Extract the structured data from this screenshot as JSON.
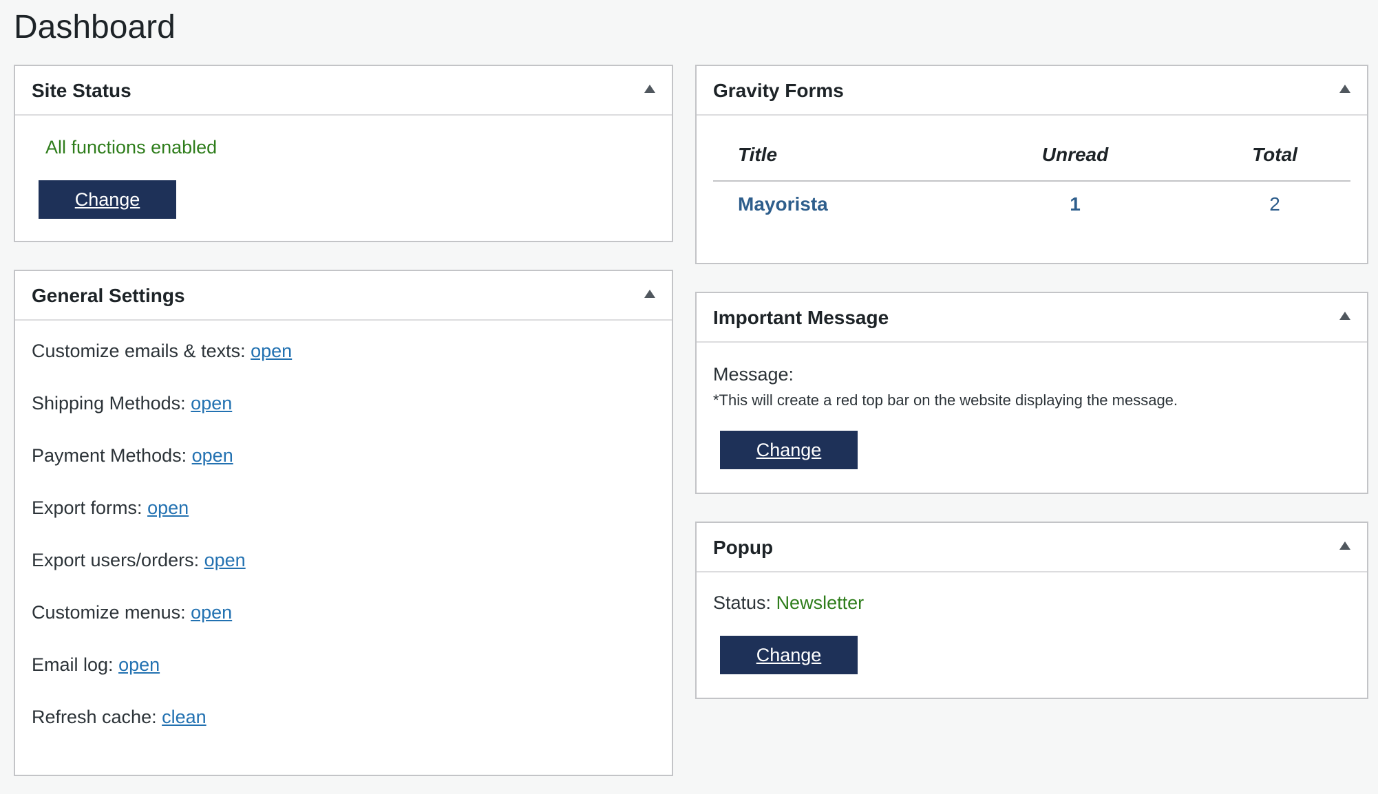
{
  "page": {
    "title": "Dashboard"
  },
  "site_status": {
    "title": "Site Status",
    "status_text": "All functions enabled",
    "button_label": "Change"
  },
  "general_settings": {
    "title": "General Settings",
    "items": [
      {
        "label": "Customize emails & texts:",
        "link": "open"
      },
      {
        "label": "Shipping Methods:",
        "link": "open"
      },
      {
        "label": "Payment Methods:",
        "link": "open"
      },
      {
        "label": "Export forms:",
        "link": "open"
      },
      {
        "label": "Export users/orders:",
        "link": "open"
      },
      {
        "label": "Customize menus:",
        "link": "open"
      },
      {
        "label": "Email log:",
        "link": "open"
      },
      {
        "label": "Refresh cache:",
        "link": "clean"
      }
    ]
  },
  "gravity_forms": {
    "title": "Gravity Forms",
    "columns": [
      "Title",
      "Unread",
      "Total"
    ],
    "rows": [
      {
        "title": "Mayorista",
        "unread": "1",
        "total": "2"
      }
    ]
  },
  "important_message": {
    "title": "Important Message",
    "label": "Message:",
    "note": "*This will create a red top bar on the website displaying the message.",
    "button_label": "Change"
  },
  "popup": {
    "title": "Popup",
    "status_label": "Status:",
    "status_value": "Newsletter",
    "button_label": "Change"
  },
  "colors": {
    "button_bg": "#1e3158",
    "success_text": "#2e7d1b",
    "link": "#2271b1"
  },
  "icons": {
    "toggle": "triangle-up-icon"
  }
}
